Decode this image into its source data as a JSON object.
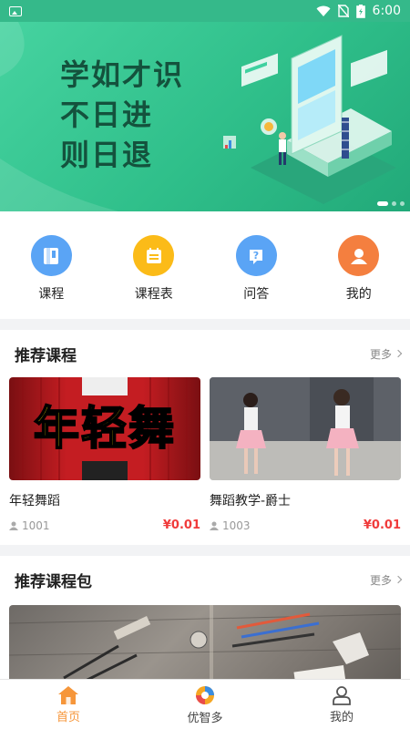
{
  "status_bar": {
    "time": "6:00"
  },
  "banner": {
    "slogan": [
      "学如才识",
      "不日进",
      "则日退"
    ],
    "slide_count": 3,
    "active_slide": 1
  },
  "quick_nav": [
    {
      "label": "课程",
      "icon": "book-icon",
      "color": "#5aa4f5"
    },
    {
      "label": "课程表",
      "icon": "schedule-icon",
      "color": "#fbbb18"
    },
    {
      "label": "问答",
      "icon": "question-icon",
      "color": "#5aa4f5"
    },
    {
      "label": "我的",
      "icon": "user-icon",
      "color": "#f47f3f"
    }
  ],
  "recommended_courses": {
    "title": "推荐课程",
    "more_label": "更多",
    "items": [
      {
        "thumb_text": "年轻舞",
        "title": "年轻舞蹈",
        "views": "1001",
        "price": "¥0.01"
      },
      {
        "title": "舞蹈教学-爵士",
        "views": "1003",
        "price": "¥0.01"
      }
    ]
  },
  "recommended_packages": {
    "title": "推荐课程包",
    "more_label": "更多"
  },
  "tabbar": [
    {
      "label": "首页",
      "icon": "home-icon",
      "active": true
    },
    {
      "label": "优智多",
      "icon": "logo-icon",
      "active": false
    },
    {
      "label": "我的",
      "icon": "profile-icon",
      "active": false
    }
  ],
  "colors": {
    "accent": "#f6963a",
    "price": "#f03b3b",
    "banner": "#35b98a"
  }
}
